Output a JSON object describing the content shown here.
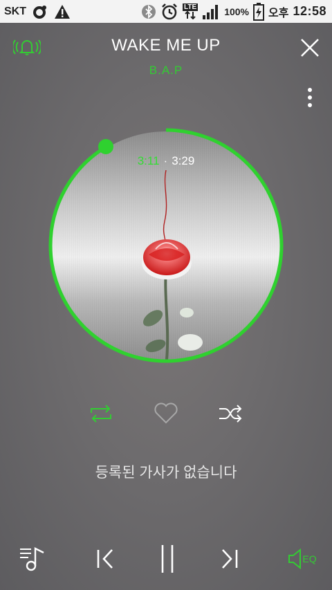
{
  "status_bar": {
    "carrier": "SKT",
    "network": "LTE",
    "battery": "100%",
    "ampm": "오후",
    "time": "12:58"
  },
  "song": {
    "title": "WAKE ME UP",
    "artist": "B.A.P"
  },
  "player": {
    "current_time": "3:11",
    "separator": "·",
    "total_time": "3:29",
    "progress": 0.913
  },
  "lyrics_message": "등록된 가사가 없습니다",
  "colors": {
    "accent": "#33cc33",
    "background": "#6d6b6d"
  },
  "controls": {
    "eq_label": "EQ"
  }
}
